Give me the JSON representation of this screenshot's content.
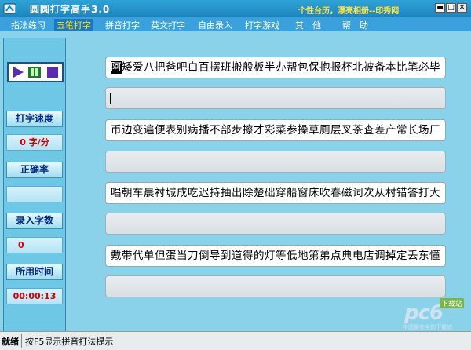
{
  "window": {
    "title": "圆圆打字高手3.0",
    "slogan": "个性台历，漂亮相册--印秀网",
    "buttons": {
      "minimize": "▬",
      "maximize": "□",
      "close": "✕"
    }
  },
  "menu": [
    {
      "label": "指法练习"
    },
    {
      "label": "五笔打字"
    },
    {
      "label": "拼音打字"
    },
    {
      "label": "英文打字"
    },
    {
      "label": "自由录入"
    },
    {
      "label": "打字游戏"
    },
    {
      "label": "其　他"
    },
    {
      "label": "帮　助"
    }
  ],
  "stats": {
    "speed_label": "打字速度",
    "speed_value": "0 字/分",
    "accuracy_label": "正确率",
    "accuracy_value": "",
    "count_label": "录入字数",
    "count_value": "0",
    "time_label": "所用时间",
    "time_value": "00:00:13"
  },
  "lines": [
    {
      "first_char": "阿",
      "text": "矮爱八把爸吧白百摆班搬般板半办帮包保抱报杯北被备本比笔必毕"
    },
    {
      "first_char": "币",
      "text": "边变遍便表别病播不部步擦才彩菜参操草厕层叉茶查差产常长场厂"
    },
    {
      "first_char": "唱",
      "text": "朝车晨衬城成吃迟持抽出除楚础穿船窗床吹春磁词次从村错答打大"
    },
    {
      "first_char": "戴",
      "text": "带代单但蛋当刀倒导到道得的灯等低地第弟点典电店调掉定丢东懂"
    }
  ],
  "statusbar": {
    "label": "就绪",
    "hint": "按F5显示拼音打法提示"
  },
  "watermark": {
    "main": "pc6",
    "badge": "下载站",
    "sub": "中国最安全的下载站"
  },
  "colors": {
    "title_bar": "#1d84bd",
    "menu_bar": "#3aa1dc",
    "active_menu_text": "#ffe400",
    "stat_value_text": "#d20000",
    "background": "#8ad2ea"
  }
}
